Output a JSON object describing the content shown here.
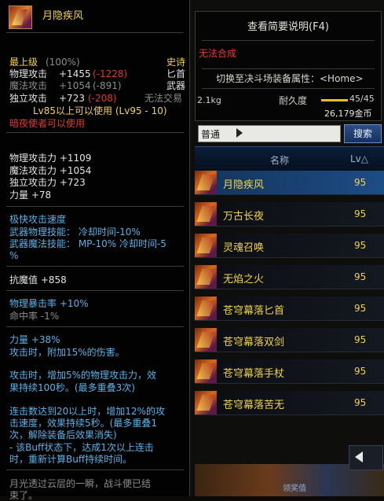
{
  "item": {
    "name": "月隐疾风",
    "grade": "最上级",
    "grade_pct": "(100%)",
    "rarity": "史诗",
    "weapon_type": "匕首",
    "category": "武器",
    "trade": "无法交易",
    "phys_atk": {
      "label": "物理攻击",
      "value": "+1455",
      "diff": "(-1228)"
    },
    "mag_atk": {
      "label": "魔法攻击",
      "value": "+1054",
      "diff": "(-891)"
    },
    "ind_atk": {
      "label": "独立攻击",
      "value": "+723",
      "diff": "(-208)"
    },
    "level_req": "Lv85以上可以使用 (Lv95 - 10)",
    "class_req": "暗夜使者可以使用"
  },
  "stats": [
    "物理攻击力 +1109",
    "魔法攻击力 +1054",
    "独立攻击力 +723",
    "力量 +78"
  ],
  "effects": {
    "line1": "极快攻击速度",
    "line2": "武器物理技能： 冷却时间-10%",
    "line3": "武器魔法技能： MP-10% 冷却时间-5",
    "line4": "%"
  },
  "resist": "抗魔值 +858",
  "crit": {
    "line1": "物理暴击率 +10%",
    "line2": "命中率 -1%"
  },
  "options": {
    "l1": "力量 +38%",
    "l2": "攻击时，附加15%的伤害。",
    "l3": "攻击时，增加5%的物理攻击力，效",
    "l4": "果持续100秒。(最多重叠3次)",
    "l5": "连击数达到20以上时，增加12%的攻",
    "l6": "击速度，效果持续5秒。(最多重叠1",
    "l7": "次，解除装备后效果消失)",
    "l8": "- 该Buff状态下，达成1次以上连击",
    "l9": "时，重新计算Buff持续时间。"
  },
  "flavor": {
    "l1": "月光透过云层的一瞬，战斗便已结",
    "l2": "束了。"
  },
  "compare": {
    "brief": "查看简要说明(F4)",
    "unsynth": "无法合成",
    "toggle": "切换至决斗场装备属性：<Home>",
    "weight": "2.1kg",
    "durability_label": "耐久度",
    "durability": "45/45",
    "durability_ratio": 1.0,
    "gold": "26,179金币"
  },
  "search": {
    "filter": "普通",
    "button": "搜索"
  },
  "list": {
    "header_name": "名称",
    "header_lv": "Lv△",
    "rows": [
      {
        "name": "月隐疾风",
        "lv": "95"
      },
      {
        "name": "万古长夜",
        "lv": "95"
      },
      {
        "name": "灵魂召唤",
        "lv": "95"
      },
      {
        "name": "无焰之火",
        "lv": "95"
      },
      {
        "name": "苍穹幕落匕首",
        "lv": "95"
      },
      {
        "name": "苍穹幕落双剑",
        "lv": "95"
      },
      {
        "name": "苍穹幕落手杖",
        "lv": "95"
      },
      {
        "name": "苍穹幕落苦无",
        "lv": "95"
      }
    ]
  },
  "footer": "领奖值"
}
